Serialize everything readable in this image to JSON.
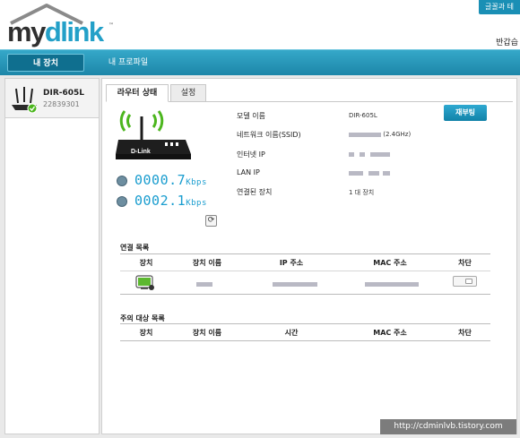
{
  "header": {
    "top_link": "글꼴과 테",
    "logo_my": "my",
    "logo_dlink": "dlink",
    "logo_tm": "™",
    "greeting": "반갑습"
  },
  "nav": {
    "tabs": [
      {
        "label": "내 장치"
      },
      {
        "label": "내 프로파일"
      }
    ]
  },
  "device_list": {
    "items": [
      {
        "name": "DIR-605L",
        "id": "22839301",
        "status": "online"
      }
    ]
  },
  "tabs": {
    "router_status": "라우터 상태",
    "settings": "설정"
  },
  "status": {
    "router_brand_label": "D-Link",
    "download_speed": "0000.7",
    "upload_speed": "0002.1",
    "speed_unit": "Kbps",
    "refresh_icon": "⟳"
  },
  "info": {
    "model_label": "모델 이름",
    "model_value": "DIR-605L",
    "ssid_label": "네트워크 이름(SSID)",
    "ssid_suffix": "(2.4GHz)",
    "internet_ip_label": "인터넷 IP",
    "lan_ip_label": "LAN IP",
    "connected_label": "연결된 장치",
    "connected_value": "1 대 장치",
    "reboot_label": "재부팅"
  },
  "connection_list": {
    "title": "연결 목록",
    "headers": [
      "장치",
      "장치 이름",
      "IP 주소",
      "MAC 주소",
      "차단"
    ]
  },
  "watch_list": {
    "title": "주의 대상 목록",
    "headers": [
      "장치",
      "장치 이름",
      "시간",
      "MAC 주소",
      "차단"
    ]
  },
  "watermark": "http://cdminlvb.tistory.com",
  "colors": {
    "accent": "#1d86a8",
    "speed_text": "#1a9dcf",
    "wifi_green": "#4cb61e"
  }
}
